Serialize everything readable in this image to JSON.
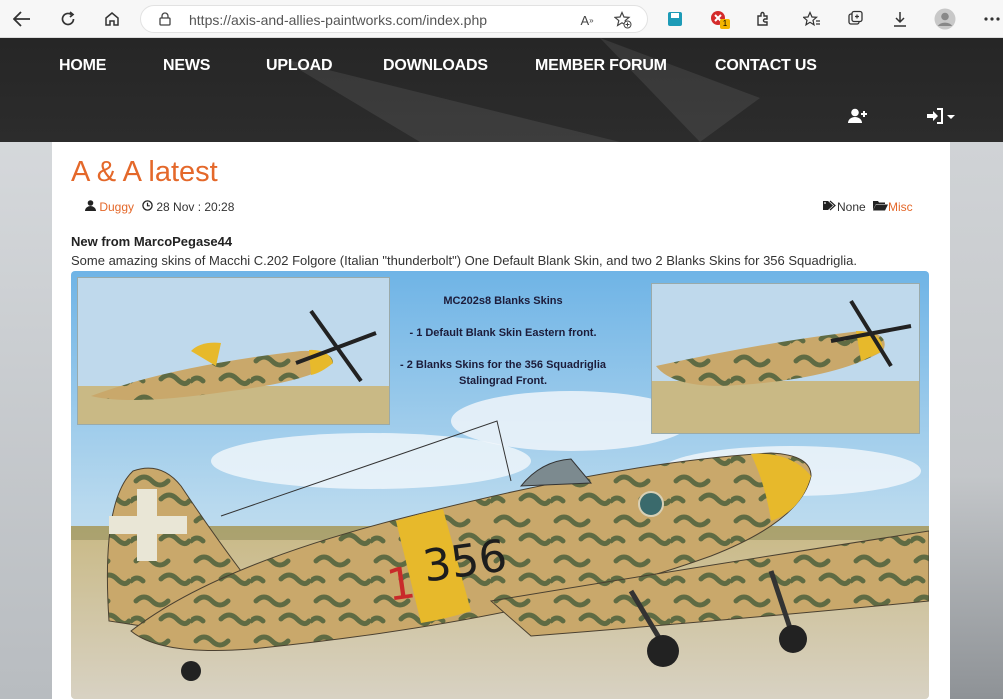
{
  "browser": {
    "url_host": "https://axis-and-allies-paintworks.com",
    "url_path": "/index.php",
    "extension_badge": "1",
    "icons": [
      "back-arrow-icon",
      "refresh-icon",
      "home-icon",
      "lock-icon",
      "read-aloud-icon",
      "favorite-add-icon",
      "collections-icon",
      "extension-error-icon",
      "extensions-icon",
      "favorites-icon",
      "tab-collections-icon",
      "download-icon",
      "profile-icon",
      "more-icon"
    ]
  },
  "nav": {
    "items": [
      "HOME",
      "NEWS",
      "UPLOAD",
      "DOWNLOADS",
      "MEMBER FORUM",
      "CONTACT US"
    ],
    "register_icon": "user-plus-icon",
    "login_icon": "sign-in-icon"
  },
  "post": {
    "title": "A & A latest",
    "author": "Duggy",
    "date": "28 Nov : 20:28",
    "tags": "None",
    "category": "Misc",
    "subtitle": "New from MarcoPegase44",
    "text": "Some amazing skins of Macchi C.202 Folgore (Italian \"thunderbolt\") One Default Blank Skin, and two 2 Blanks Skins for 356 Squadriglia."
  },
  "hero": {
    "caption_title": "MC202s8  Blanks Skins",
    "caption_line1": "- 1 Default Blank Skin Eastern front.",
    "caption_line2": "- 2 Blanks Skins for the 356 Squadriglia",
    "caption_line3": "Stalingrad Front.",
    "plane_number": "356",
    "plane_prefix": "1"
  },
  "colors": {
    "accent": "#e4682a",
    "header_bg": "#2a2a2a",
    "title_color": "#e4682a"
  }
}
